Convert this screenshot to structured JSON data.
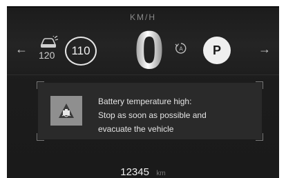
{
  "cluster": {
    "speed_unit": "KM/H",
    "current_speed": "0",
    "cruise_set_speed": "120",
    "speed_limit": "110",
    "gear": "P",
    "auto_hold_icon": "auto-hold-icon",
    "cruise_icon": "adaptive-cruise-car-icon",
    "left_arrow": "←",
    "right_arrow": "→"
  },
  "alert": {
    "icon": "battery-temperature-warning-icon",
    "lines": [
      "Battery temperature high:",
      "Stop as soon as possible and",
      "evacuate the vehicle"
    ]
  },
  "odometer": {
    "value": "12345",
    "unit": "km"
  }
}
